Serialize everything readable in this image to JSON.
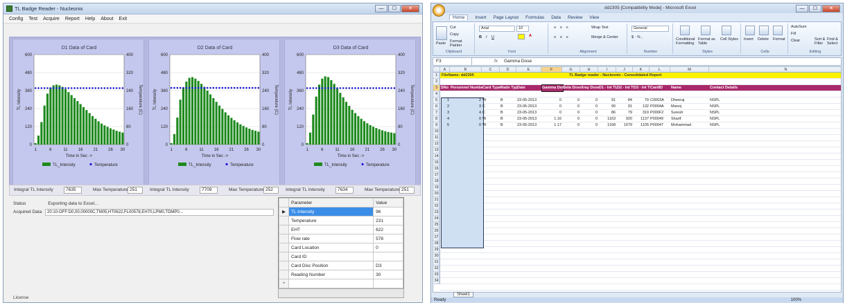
{
  "app": {
    "title": "TL Badge Reader - Nucleonix",
    "menu": [
      "Config",
      "Test",
      "Acquire",
      "Report",
      "Help",
      "About",
      "Exit"
    ],
    "window_controls": {
      "minimize": "—",
      "maximize": "☐",
      "close": "✕"
    },
    "panels": [
      {
        "title": "D1 Data of Card",
        "integral_label": "Integral TL Intensity",
        "integral_value": "7635",
        "maxtemp_label": "Max Temperature",
        "maxtemp_value": "251"
      },
      {
        "title": "D2 Data of Card",
        "integral_label": "Integral TL Intensity",
        "integral_value": "7709",
        "maxtemp_label": "Max Temperature",
        "maxtemp_value": "252"
      },
      {
        "title": "D3 Data of Card",
        "integral_label": "Integral TL Intensity",
        "integral_value": "7634",
        "maxtemp_label": "Max Temperature",
        "maxtemp_value": "251"
      }
    ],
    "status_label": "Status",
    "status_value": "Exporting data to Excel...",
    "acquired_label": "Acquired Data",
    "acquired_value": "20:10-OFF:D0,00,00000C,TM05,HT0622,FL00578,EH70,LPM0,TDMP0...",
    "grid": {
      "headers": [
        "Parameter",
        "Value"
      ],
      "rows": [
        [
          "TL Intensity",
          "96"
        ],
        [
          "Temperature",
          "231"
        ],
        [
          "EHT",
          "622"
        ],
        [
          "Flow rate",
          "578"
        ],
        [
          "Card Location",
          "0"
        ],
        [
          "Card ID",
          ""
        ],
        [
          "Card Disc Position",
          "D3"
        ],
        [
          "Reading Number",
          "30"
        ]
      ],
      "selected_marker": "▶",
      "new_row_marker": "*"
    },
    "license_label": "License"
  },
  "chart_data": [
    {
      "type": "bar",
      "title": "D1 Data of Card",
      "xlabel": "Time in Sec ->",
      "ylabel": "TL Intensity",
      "y2label": "Temperature (C)",
      "xticks": [
        "1",
        "6",
        "11",
        "16",
        "21",
        "26",
        "30"
      ],
      "yticks": [
        "0",
        "120",
        "240",
        "360",
        "480",
        "600"
      ],
      "y2ticks": [
        "0",
        "80",
        "160",
        "240",
        "320",
        "400"
      ],
      "ylim": [
        0,
        600
      ],
      "y2lim": [
        0,
        400
      ],
      "legend": [
        "TL_Intensity",
        "Temperature"
      ],
      "legend_position": "bottom",
      "series": [
        {
          "name": "TL_Intensity",
          "values": [
            10,
            60,
            150,
            260,
            340,
            380,
            395,
            400,
            395,
            385,
            370,
            350,
            330,
            310,
            290,
            270,
            250,
            230,
            210,
            190,
            172,
            155,
            140,
            128,
            118,
            108,
            100,
            92,
            86,
            80
          ]
        },
        {
          "name": "Temperature",
          "values": [
            251,
            251,
            251,
            251,
            251,
            251,
            251,
            251,
            251,
            251,
            251,
            251,
            251,
            251,
            251,
            251,
            251,
            251,
            251,
            251,
            251,
            251,
            251,
            251,
            251,
            251,
            251,
            251,
            251,
            251
          ]
        }
      ],
      "colors": {
        "bar": "#1e8a1e",
        "temperature": "#1a1ad0"
      }
    },
    {
      "type": "bar",
      "title": "D2 Data of Card",
      "xlabel": "Time in Sec ->",
      "ylabel": "TL Intensity",
      "y2label": "Temperature (C)",
      "xticks": [
        "1",
        "6",
        "11",
        "16",
        "21",
        "26",
        "30"
      ],
      "yticks": [
        "0",
        "120",
        "240",
        "360",
        "480",
        "600"
      ],
      "y2ticks": [
        "0",
        "80",
        "160",
        "240",
        "320",
        "400"
      ],
      "ylim": [
        0,
        600
      ],
      "y2lim": [
        0,
        400
      ],
      "legend": [
        "TL_Intensity",
        "Temperature"
      ],
      "legend_position": "bottom",
      "series": [
        {
          "name": "TL_Intensity",
          "values": [
            10,
            70,
            180,
            300,
            380,
            420,
            445,
            450,
            440,
            425,
            405,
            385,
            360,
            335,
            310,
            285,
            260,
            238,
            215,
            195,
            178,
            162,
            148,
            135,
            124,
            114,
            106,
            98,
            92,
            86
          ]
        },
        {
          "name": "Temperature",
          "values": [
            252,
            252,
            252,
            252,
            252,
            252,
            252,
            252,
            252,
            252,
            252,
            252,
            252,
            252,
            252,
            252,
            252,
            252,
            252,
            252,
            252,
            252,
            252,
            252,
            252,
            252,
            252,
            252,
            252,
            252
          ]
        }
      ],
      "colors": {
        "bar": "#1e8a1e",
        "temperature": "#1a1ad0"
      }
    },
    {
      "type": "bar",
      "title": "D3 Data of Card",
      "xlabel": "Time in Sec ->",
      "ylabel": "TL Intensity",
      "y2label": "Temperature (C)",
      "xticks": [
        "1",
        "6",
        "11",
        "16",
        "21",
        "26",
        "30"
      ],
      "yticks": [
        "0",
        "120",
        "240",
        "360",
        "480",
        "600"
      ],
      "y2ticks": [
        "0",
        "80",
        "160",
        "240",
        "320",
        "400"
      ],
      "ylim": [
        0,
        600
      ],
      "y2lim": [
        0,
        400
      ],
      "legend": [
        "TL_Intensity",
        "Temperature"
      ],
      "legend_position": "bottom",
      "series": [
        {
          "name": "TL_Intensity",
          "values": [
            10,
            80,
            200,
            320,
            400,
            440,
            455,
            450,
            430,
            405,
            375,
            345,
            315,
            285,
            258,
            232,
            210,
            190,
            172,
            156,
            142,
            130,
            119,
            110,
            102,
            95,
            89,
            84,
            80,
            76
          ]
        },
        {
          "name": "Temperature",
          "values": [
            251,
            251,
            251,
            251,
            251,
            251,
            251,
            251,
            251,
            251,
            251,
            251,
            251,
            251,
            251,
            251,
            251,
            251,
            251,
            251,
            251,
            251,
            251,
            251,
            251,
            251,
            251,
            251,
            251,
            251
          ]
        }
      ],
      "colors": {
        "bar": "#1e8a1e",
        "temperature": "#1a1ad0"
      }
    }
  ],
  "excel": {
    "title": "dd2305 [Compatibility Mode] - Microsoft Excel",
    "tabs": [
      "Home",
      "Insert",
      "Page Layout",
      "Formulas",
      "Data",
      "Review",
      "View"
    ],
    "ribbon": {
      "clipboard": {
        "paste": "Paste",
        "cut": "Cut",
        "copy": "Copy",
        "format_painter": "Format Painter",
        "label": "Clipboard"
      },
      "font": {
        "name": "Arial",
        "size": "10",
        "label": "Font"
      },
      "alignment": {
        "wrap": "Wrap Text",
        "merge": "Merge & Center",
        "label": "Alignment"
      },
      "number": {
        "format": "General",
        "label": "Number"
      },
      "styles": {
        "conditional": "Conditional Formatting",
        "table": "Format as Table",
        "cell": "Cell Styles",
        "label": "Styles"
      },
      "cells": {
        "insert": "Insert",
        "delete": "Delete",
        "format": "Format",
        "label": "Cells"
      },
      "editing": {
        "autosum": "AutoSum",
        "fill": "Fill",
        "clear": "Clear",
        "sort": "Sort & Filter",
        "find": "Find & Select",
        "label": "Editing"
      }
    },
    "namebox": "F3",
    "fx": "fx",
    "formula": "Gamma Dose",
    "columns": [
      "A",
      "B",
      "C",
      "D",
      "E",
      "F",
      "G",
      "H",
      "I",
      "J",
      "K",
      "L",
      "M",
      "N"
    ],
    "row1_left": "FileName: dd2305",
    "row1_right": "TL Badge reader - Nucleonix - Consolidated Report",
    "headers": [
      "SNo",
      "Personnel Number",
      "Card Type",
      "Radn Type",
      "Date",
      "Gamma Dose",
      "Beta Dose",
      "Xray Dose",
      "D1 - Int TL",
      "D2 - Int TL",
      "D3 - Int TL",
      "CardID",
      "Name",
      "Contact Details"
    ],
    "rows": [
      [
        "1",
        "2",
        "W",
        "B",
        "23-05-2013",
        "0",
        "0",
        "0",
        "91",
        "84",
        "79",
        "C0003A",
        "Dheeraj",
        "NSPL"
      ],
      [
        "2",
        "3",
        "C",
        "B",
        "23-05-2013",
        "0",
        "0",
        "0",
        "90",
        "91",
        "132",
        "P0004A",
        "Manoj",
        "NSPL"
      ],
      [
        "3",
        "4",
        "C",
        "B",
        "23-05-2013",
        "0",
        "0",
        "0",
        "86",
        "79",
        "319",
        "P000F2",
        "Suresh",
        "NSPL"
      ],
      [
        "4",
        "0",
        "W",
        "B",
        "23-05-2013",
        "1.16",
        "0",
        "0",
        "1163",
        "920",
        "1137",
        "P00049",
        "Sharif",
        "NSPL"
      ],
      [
        "5",
        "0",
        "W",
        "B",
        "23-05-2013",
        "1.17",
        "0",
        "0",
        "1168",
        "1079",
        "1105",
        "P00047",
        "Mohammad",
        "NSPL"
      ]
    ],
    "row_numbers": [
      "1",
      "2",
      "3",
      "4",
      "5",
      "6",
      "7",
      "8",
      "9",
      "10",
      "11",
      "12",
      "13",
      "14",
      "15",
      "16",
      "17",
      "18",
      "19",
      "20",
      "21",
      "22",
      "23",
      "24",
      "25",
      "26",
      "27",
      "28",
      "29",
      "30",
      "31",
      "32",
      "33",
      "34"
    ],
    "sheet_tab": "Sheet1",
    "status": "Ready",
    "zoom": "100%"
  }
}
